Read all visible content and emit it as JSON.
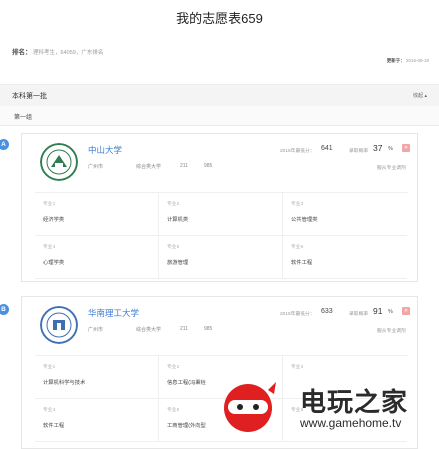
{
  "title": "我的志愿表659",
  "rank": {
    "label": "排名：",
    "value": "理科考生，64059，广东排名"
  },
  "updated": {
    "label": "更新于：",
    "value": "2016-06-18"
  },
  "batch": {
    "title": "本科第一批",
    "collapse": "收起 ▴"
  },
  "group": {
    "title": "第一组"
  },
  "unis": [
    {
      "marker": "A",
      "name": "中山大学",
      "city": "广州市",
      "type": "综合类大学",
      "t211": "211",
      "t985": "985",
      "min_label": "2015年最低分：",
      "min_score": "641",
      "prob_label": "录取概率",
      "prob": "37",
      "pct": "%",
      "adjust": "服从专业调剂",
      "logo_color": "#2e7d4f",
      "majors": [
        {
          "slot": "专业1",
          "name": "经济学类"
        },
        {
          "slot": "专业2",
          "name": "计算机类"
        },
        {
          "slot": "专业3",
          "name": "公共管理类"
        },
        {
          "slot": "专业4",
          "name": "心理学类"
        },
        {
          "slot": "专业5",
          "name": "旅游管理"
        },
        {
          "slot": "专业6",
          "name": "软件工程"
        }
      ]
    },
    {
      "marker": "B",
      "name": "华南理工大学",
      "city": "广州市",
      "type": "综合类大学",
      "t211": "211",
      "t985": "985",
      "min_label": "2015年最低分：",
      "min_score": "633",
      "prob_label": "录取概率",
      "prob": "91",
      "pct": "%",
      "adjust": "服从专业调剂",
      "logo_color": "#3f6fb3",
      "majors": [
        {
          "slot": "专业1",
          "name": "计算机科学与技术"
        },
        {
          "slot": "专业2",
          "name": "信息工程(冯秉铨"
        },
        {
          "slot": "专业3",
          "name": ""
        },
        {
          "slot": "专业4",
          "name": "软件工程"
        },
        {
          "slot": "专业5",
          "name": "工商管理(外向型"
        },
        {
          "slot": "专业6",
          "name": ""
        }
      ]
    }
  ],
  "watermark": {
    "title": "电玩之家",
    "url": "www.gamehome.tv"
  },
  "colors": {
    "accent": "#3a7bd5",
    "delete": "#f3a5a5",
    "marker": "#4a90e2"
  }
}
